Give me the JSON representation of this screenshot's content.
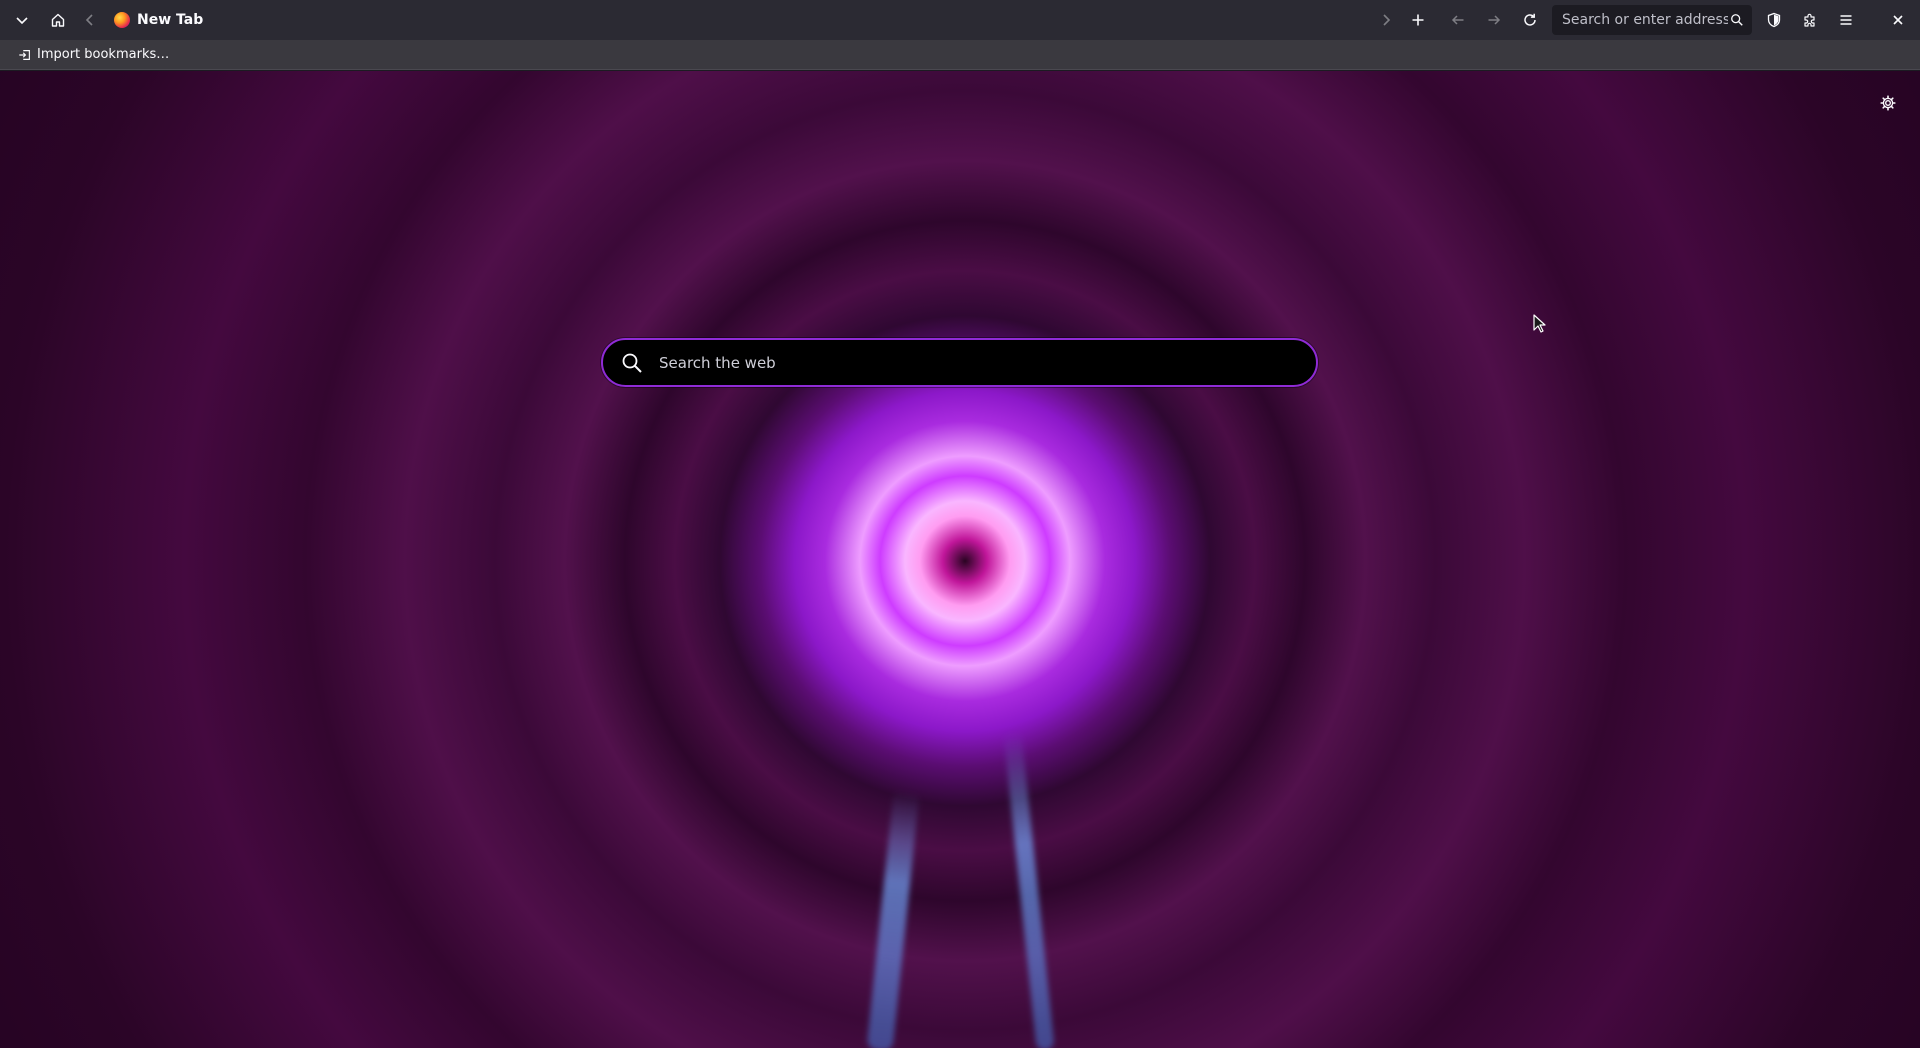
{
  "toolbar": {
    "tab_title": "New Tab",
    "urlbar_placeholder": "Search or enter address",
    "icons": [
      "chevron-down-icon",
      "home-icon",
      "chevron-left-icon",
      "firefox-icon",
      "chevron-right-icon",
      "plus-icon",
      "back-arrow-icon",
      "forward-arrow-icon",
      "reload-icon",
      "search-icon",
      "shield-icon",
      "puzzle-icon",
      "hamburger-menu-icon",
      "close-icon"
    ]
  },
  "bookmarks": {
    "import_label": "Import bookmarks…",
    "icon": "import-icon"
  },
  "newtab": {
    "search_placeholder": "Search the web",
    "settings_icon": "gear-icon"
  },
  "colors": {
    "toolbar_bg": "#2b2a33",
    "bookmarks_bg": "#3a393f",
    "search_border": "#8f2bd6",
    "wallpaper_accent": "#c23bff"
  }
}
